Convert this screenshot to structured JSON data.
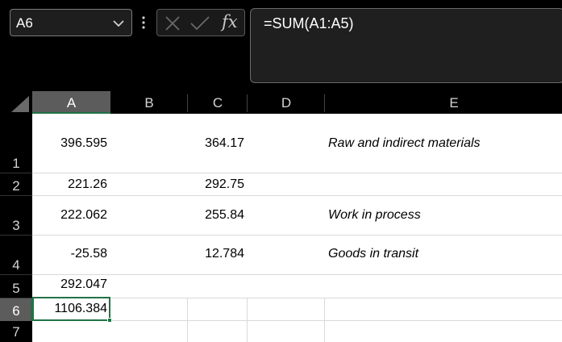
{
  "name_box": {
    "value": "A6"
  },
  "icons": {
    "chevron": "chevron-down-icon",
    "more": "vertical-ellipsis-icon",
    "cancel": "cancel-x-icon",
    "enter": "enter-checkmark-icon",
    "function": "insert-function-icon"
  },
  "formula_bar": {
    "fx_label": "fx",
    "value": "=SUM(A1:A5)"
  },
  "columns": [
    "A",
    "B",
    "C",
    "D",
    "E"
  ],
  "selected_column": "A",
  "rows": [
    "1",
    "2",
    "3",
    "4",
    "5",
    "6",
    "7"
  ],
  "selected_row": "6",
  "cells": {
    "A1": "396.595",
    "C1": "364.17",
    "E1": "Raw and indirect materials",
    "A2": "221.26",
    "C2": "292.75",
    "A3": "222.062",
    "C3": "255.84",
    "E3": "Work in process",
    "A4": "-25.58",
    "C4": "12.784",
    "E4": "Goods in transit",
    "A5": "292.047",
    "A6": "1106.384"
  },
  "colors": {
    "selection": "#217346",
    "header_selected": "#5c5c5c",
    "gridline": "#d9d9d9"
  }
}
